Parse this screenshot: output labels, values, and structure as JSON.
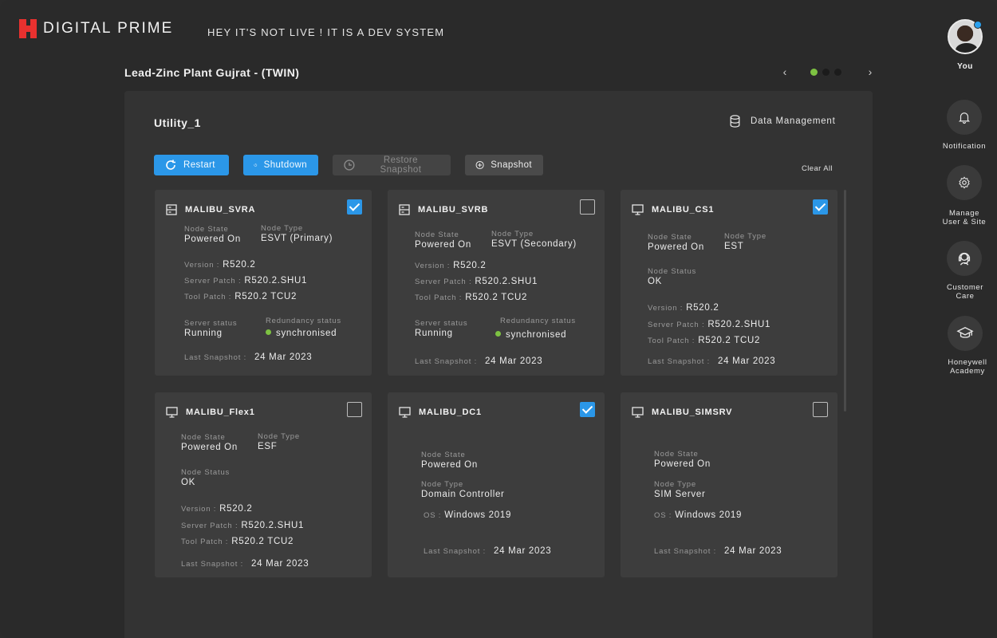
{
  "header": {
    "brand": "DIGITAL PRIME",
    "dev_banner": "HEY IT'S NOT LIVE !  IT IS A DEV SYSTEM",
    "plant_title": "Lead-Zinc Plant Gujrat   - (TWIN)"
  },
  "pager": {
    "prev": "‹",
    "next": "›",
    "pages": 3,
    "active_page": 1,
    "active_color": "#7dc242"
  },
  "rail": {
    "user_label": "You",
    "items": [
      {
        "icon": "bell-icon",
        "label": "Notification"
      },
      {
        "icon": "gear-icon",
        "label": "Manage\nUser & Site"
      },
      {
        "icon": "headset-icon",
        "label": "Customer\nCare"
      },
      {
        "icon": "graduation-cap-icon",
        "label": "Honeywell\nAcademy"
      }
    ]
  },
  "panel": {
    "title": "Utility_1",
    "data_management": "Data Management",
    "clear_all": "Clear All",
    "toolbar": {
      "restart": "Restart",
      "shutdown": "Shutdown",
      "restore_snapshot": "Restore Snapshot",
      "snapshot": "Snapshot"
    }
  },
  "labels": {
    "node_state": "Node State",
    "node_type": "Node Type",
    "node_status": "Node Status",
    "version": "Version :",
    "server_patch": "Server Patch :",
    "tool_patch": "Tool Patch :",
    "server_status": "Server status",
    "redundancy_status": "Redundancy status",
    "last_snapshot": "Last Snapshot :",
    "os": "OS :"
  },
  "nodes": [
    {
      "name": "MALIBU_SVRA",
      "icon": "server-icon",
      "checked": true,
      "node_state": "Powered On",
      "node_type": "ESVT (Primary)",
      "version": "R520.2",
      "server_patch": "R520.2.SHU1",
      "tool_patch": "R520.2 TCU2",
      "server_status": "Running",
      "redundancy_status": "synchronised",
      "last_snapshot": "24 Mar 2023"
    },
    {
      "name": "MALIBU_SVRB",
      "icon": "server-icon",
      "checked": false,
      "node_state": "Powered On",
      "node_type": "ESVT (Secondary)",
      "version": "R520.2",
      "server_patch": "R520.2.SHU1",
      "tool_patch": "R520.2 TCU2",
      "server_status": "Running",
      "redundancy_status": "synchronised",
      "last_snapshot": "24 Mar 2023"
    },
    {
      "name": "MALIBU_CS1",
      "icon": "monitor-icon",
      "checked": true,
      "node_state": "Powered On",
      "node_type": "EST",
      "node_status": "OK",
      "version": "R520.2",
      "server_patch": "R520.2.SHU1",
      "tool_patch": "R520.2 TCU2",
      "last_snapshot": "24 Mar 2023"
    },
    {
      "name": "MALIBU_Flex1",
      "icon": "monitor-icon",
      "checked": false,
      "node_state": "Powered On",
      "node_type": "ESF",
      "node_status": "OK",
      "version": "R520.2",
      "server_patch": "R520.2.SHU1",
      "tool_patch": "R520.2 TCU2",
      "last_snapshot": "24 Mar 2023"
    },
    {
      "name": "MALIBU_DC1",
      "icon": "monitor-icon",
      "checked": true,
      "node_state": "Powered On",
      "node_type": "Domain Controller",
      "os": "Windows 2019",
      "last_snapshot": "24 Mar 2023"
    },
    {
      "name": "MALIBU_SIMSRV",
      "icon": "monitor-icon",
      "checked": false,
      "node_state": "Powered On",
      "node_type": "SIM Server",
      "os": "Windows 2019",
      "last_snapshot": "24 Mar 2023"
    }
  ],
  "colors": {
    "accent": "#2b97e8",
    "green": "#7dc242",
    "brand_red": "#e8312f"
  }
}
